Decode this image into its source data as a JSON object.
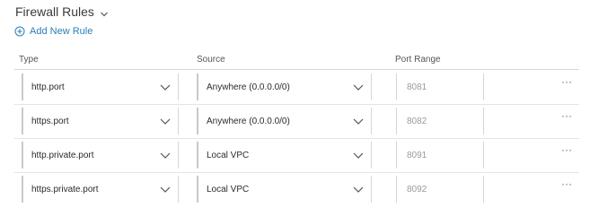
{
  "header": {
    "title": "Firewall Rules"
  },
  "actions": {
    "add_rule_label": "Add New Rule"
  },
  "columns": {
    "type": "Type",
    "source": "Source",
    "port_range": "Port Range"
  },
  "rules": [
    {
      "type": "http.port",
      "source": "Anywhere (0.0.0.0/0)",
      "port": "8081",
      "more": "···"
    },
    {
      "type": "https.port",
      "source": "Anywhere (0.0.0.0/0)",
      "port": "8082",
      "more": "···"
    },
    {
      "type": "http.private.port",
      "source": "Local VPC",
      "port": "8091",
      "more": "···"
    },
    {
      "type": "https.private.port",
      "source": "Local VPC",
      "port": "8092",
      "more": "···"
    }
  ],
  "colors": {
    "accent": "#2a7fb8",
    "divider": "#d6d6d6"
  }
}
